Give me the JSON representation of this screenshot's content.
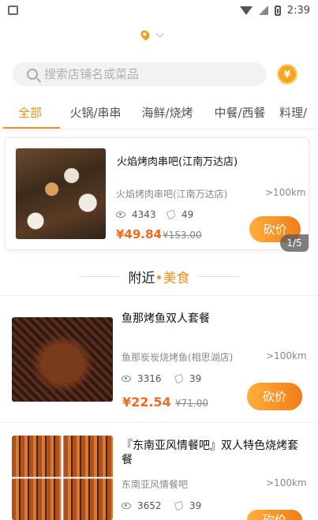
{
  "status_bar": {
    "time": "2:39"
  },
  "search": {
    "placeholder": "搜索店铺名或菜品"
  },
  "coin_symbol": "¥",
  "tabs": [
    {
      "label": "全部",
      "active": true
    },
    {
      "label": "火锅/串串"
    },
    {
      "label": "海鲜/烧烤"
    },
    {
      "label": "中餐/西餐"
    },
    {
      "label": "料理/"
    }
  ],
  "featured": {
    "title": "火焰烤肉串吧(江南万达店)",
    "shop": "火焰烤肉串吧(江南万达店)",
    "distance": ">100km",
    "views": "4343",
    "likes": "49",
    "price": "¥49.84",
    "old_price": "¥153.00",
    "button": "砍价",
    "pager": "1/5"
  },
  "section": {
    "title_main": "附近",
    "title_accent": "•美食"
  },
  "items": [
    {
      "title": "鱼那烤鱼双人套餐",
      "shop": "鱼那炭炭烧烤鱼(相思湖店)",
      "distance": ">100km",
      "views": "3316",
      "likes": "39",
      "price": "¥22.54",
      "old_price": "¥71.00",
      "button": "砍价"
    },
    {
      "title": "『东南亚风情餐吧』双人特色烧烤套餐",
      "shop": "东南亚风情餐吧",
      "distance": ">100km",
      "views": "3652",
      "likes": "39",
      "button": "砍价"
    }
  ]
}
